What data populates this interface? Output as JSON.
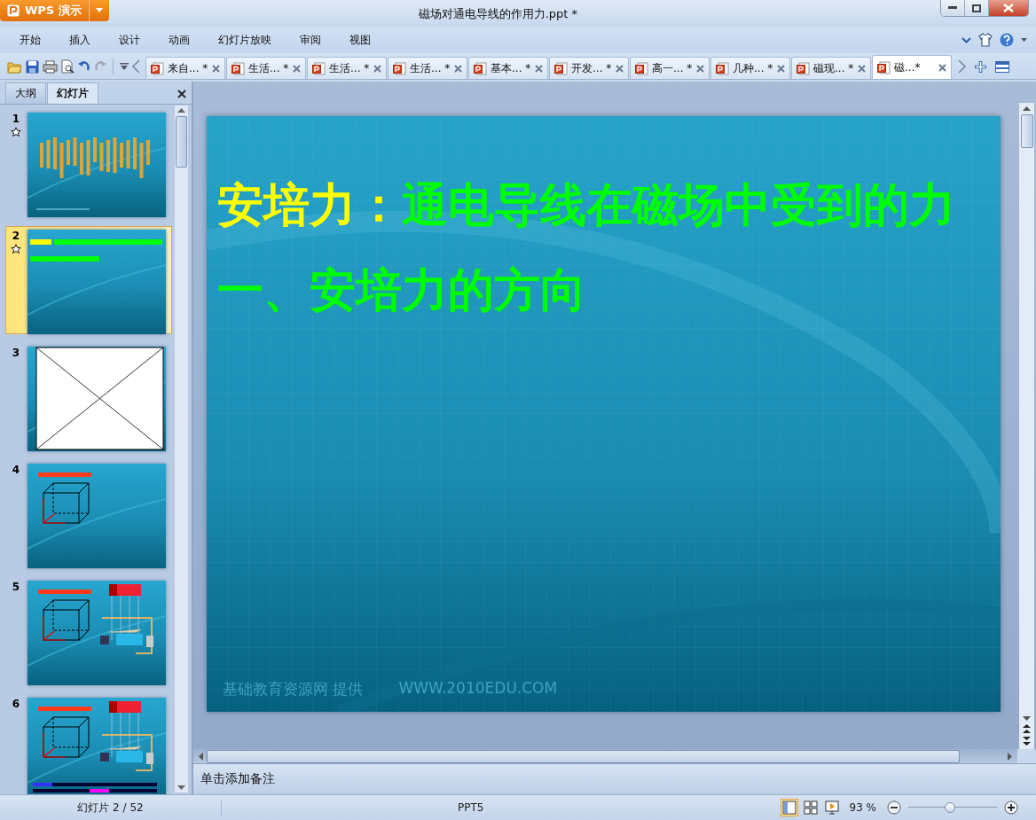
{
  "app": {
    "logo": "WPS 演示"
  },
  "window": {
    "title": "磁场对通电导线的作用力.ppt *"
  },
  "menu": [
    "开始",
    "插入",
    "设计",
    "动画",
    "幻灯片放映",
    "审阅",
    "视图"
  ],
  "doc_tabs": [
    {
      "label": "来自... *",
      "selected": false
    },
    {
      "label": "生活... *",
      "selected": false
    },
    {
      "label": "生活... *",
      "selected": false
    },
    {
      "label": "生活... *",
      "selected": false
    },
    {
      "label": "基本... *",
      "selected": false
    },
    {
      "label": "开发... *",
      "selected": false
    },
    {
      "label": "高一... *",
      "selected": false
    },
    {
      "label": "几种... *",
      "selected": false
    },
    {
      "label": "磁现... *",
      "selected": false
    },
    {
      "label": "磁...*",
      "selected": true
    }
  ],
  "side_panel": {
    "tabs": [
      {
        "label": "大纲",
        "selected": false
      },
      {
        "label": "幻灯片",
        "selected": true
      }
    ],
    "thumbnails": [
      {
        "number": "1",
        "kind": "title",
        "has_transition": true,
        "selected": false
      },
      {
        "number": "2",
        "kind": "text",
        "has_transition": true,
        "selected": true
      },
      {
        "number": "3",
        "kind": "placeholder",
        "has_transition": false,
        "selected": false
      },
      {
        "number": "4",
        "kind": "cube",
        "has_transition": false,
        "selected": false
      },
      {
        "number": "5",
        "kind": "cube-magnet",
        "has_transition": false,
        "selected": false
      },
      {
        "number": "6",
        "kind": "cube-magnet-text",
        "has_transition": false,
        "selected": false
      }
    ]
  },
  "slide": {
    "title": [
      {
        "text": "安培力：",
        "color": "#ffff00"
      },
      {
        "text": "通电导线在磁场中受到的力",
        "color": "#00ff00"
      }
    ],
    "subtitle": {
      "text": "一、安培力的方向",
      "color": "#00ff00"
    },
    "footer": "基础教育资源网  提供",
    "footer_url": "WWW.2010EDU.COM"
  },
  "notes": {
    "placeholder": "单击添加备注"
  },
  "status_bar": {
    "slide_position": "幻灯片 2 / 52",
    "template": "PPT5",
    "zoom": "93 %",
    "zoom_slider": {
      "level": 0.47
    },
    "views": [
      {
        "kind": "normal",
        "selected": true
      },
      {
        "kind": "sorter",
        "selected": false
      },
      {
        "kind": "show",
        "selected": false
      }
    ]
  }
}
